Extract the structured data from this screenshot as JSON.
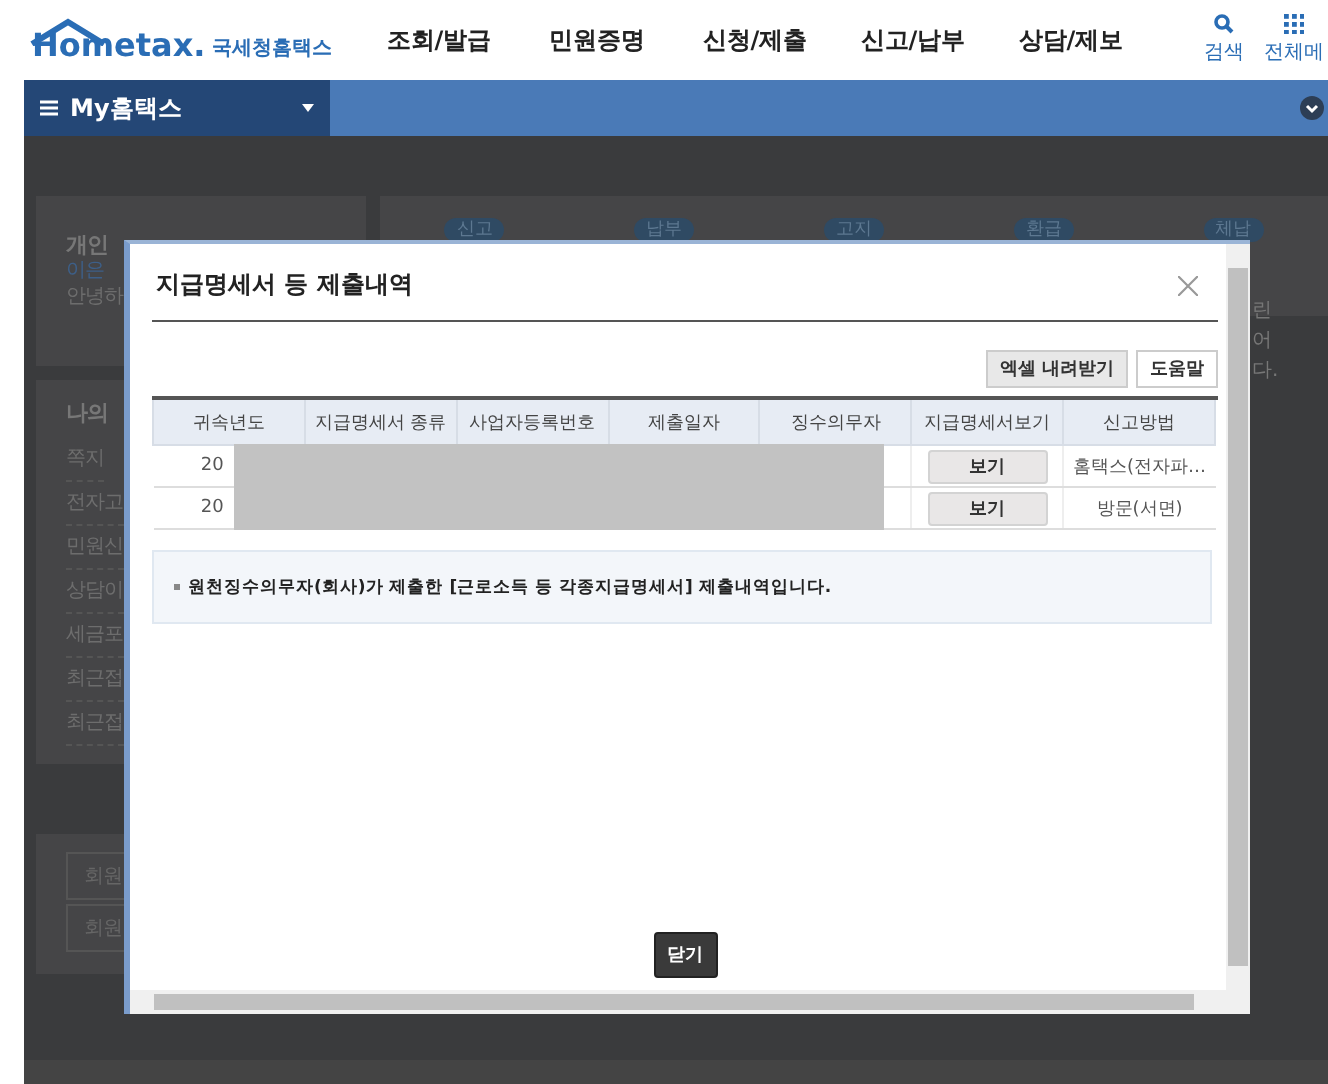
{
  "header": {
    "logo": {
      "brand": "Hometax.",
      "name": "국세청홈택스"
    },
    "nav": [
      "조회/발급",
      "민원증명",
      "신청/제출",
      "신고/납부",
      "상담/제보"
    ],
    "tools": [
      {
        "kind": "search",
        "label": "검색"
      },
      {
        "kind": "menu",
        "label": "전체메"
      }
    ]
  },
  "menu_bar": {
    "title": "My홈택스"
  },
  "background": {
    "profile": [
      "개인",
      "이은",
      "안녕하"
    ],
    "my_menu": {
      "title": "나의",
      "items": [
        "쪽지",
        "전자고",
        "민원신",
        "상담이",
        "세금포",
        "최근접",
        "최근접"
      ]
    },
    "member_buttons": [
      "회원",
      "회원"
    ],
    "badges": [
      "신고",
      "납부",
      "고지",
      "환급",
      "체납"
    ],
    "notice_fragments": [
      "린",
      "어",
      "다."
    ]
  },
  "dialog": {
    "title": "지급명세서 등 제출내역",
    "actions": [
      "엑셀 내려받기",
      "도움말"
    ],
    "table": {
      "columns": [
        "귀속년도",
        "지급명세서 종류",
        "사업자등록번호",
        "제출일자",
        "징수의무자",
        "지급명세서보기",
        "신고방법"
      ],
      "rows": [
        {
          "year": "20",
          "view_button": "보기",
          "method": "홈택스(전자파…"
        },
        {
          "year": "20",
          "view_button": "보기",
          "method": "방문(서면)"
        }
      ]
    },
    "note": "원천징수의무자(회사)가 제출한 [근로소득 등 각종지급명세서] 제출내역입니다.",
    "close_button": "닫기"
  }
}
